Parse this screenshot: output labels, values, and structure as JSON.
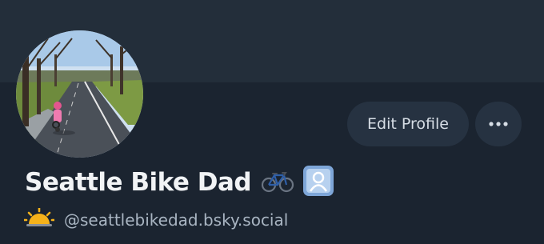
{
  "profile": {
    "display_name": "Seattle Bike Dad",
    "name_emojis": [
      "bicycle-emoji",
      "person-in-frame-emoji"
    ],
    "handle_emoji": "sunrise-emoji",
    "handle": "@seattlebikedad.bsky.social"
  },
  "actions": {
    "edit_profile_label": "Edit Profile",
    "more_icon": "ellipsis-icon"
  },
  "colors": {
    "background": "#1b2430",
    "banner": "#232e3a",
    "button_bg": "#263241",
    "name_text": "#f1f3f5",
    "handle_text": "#a9b5c2"
  }
}
